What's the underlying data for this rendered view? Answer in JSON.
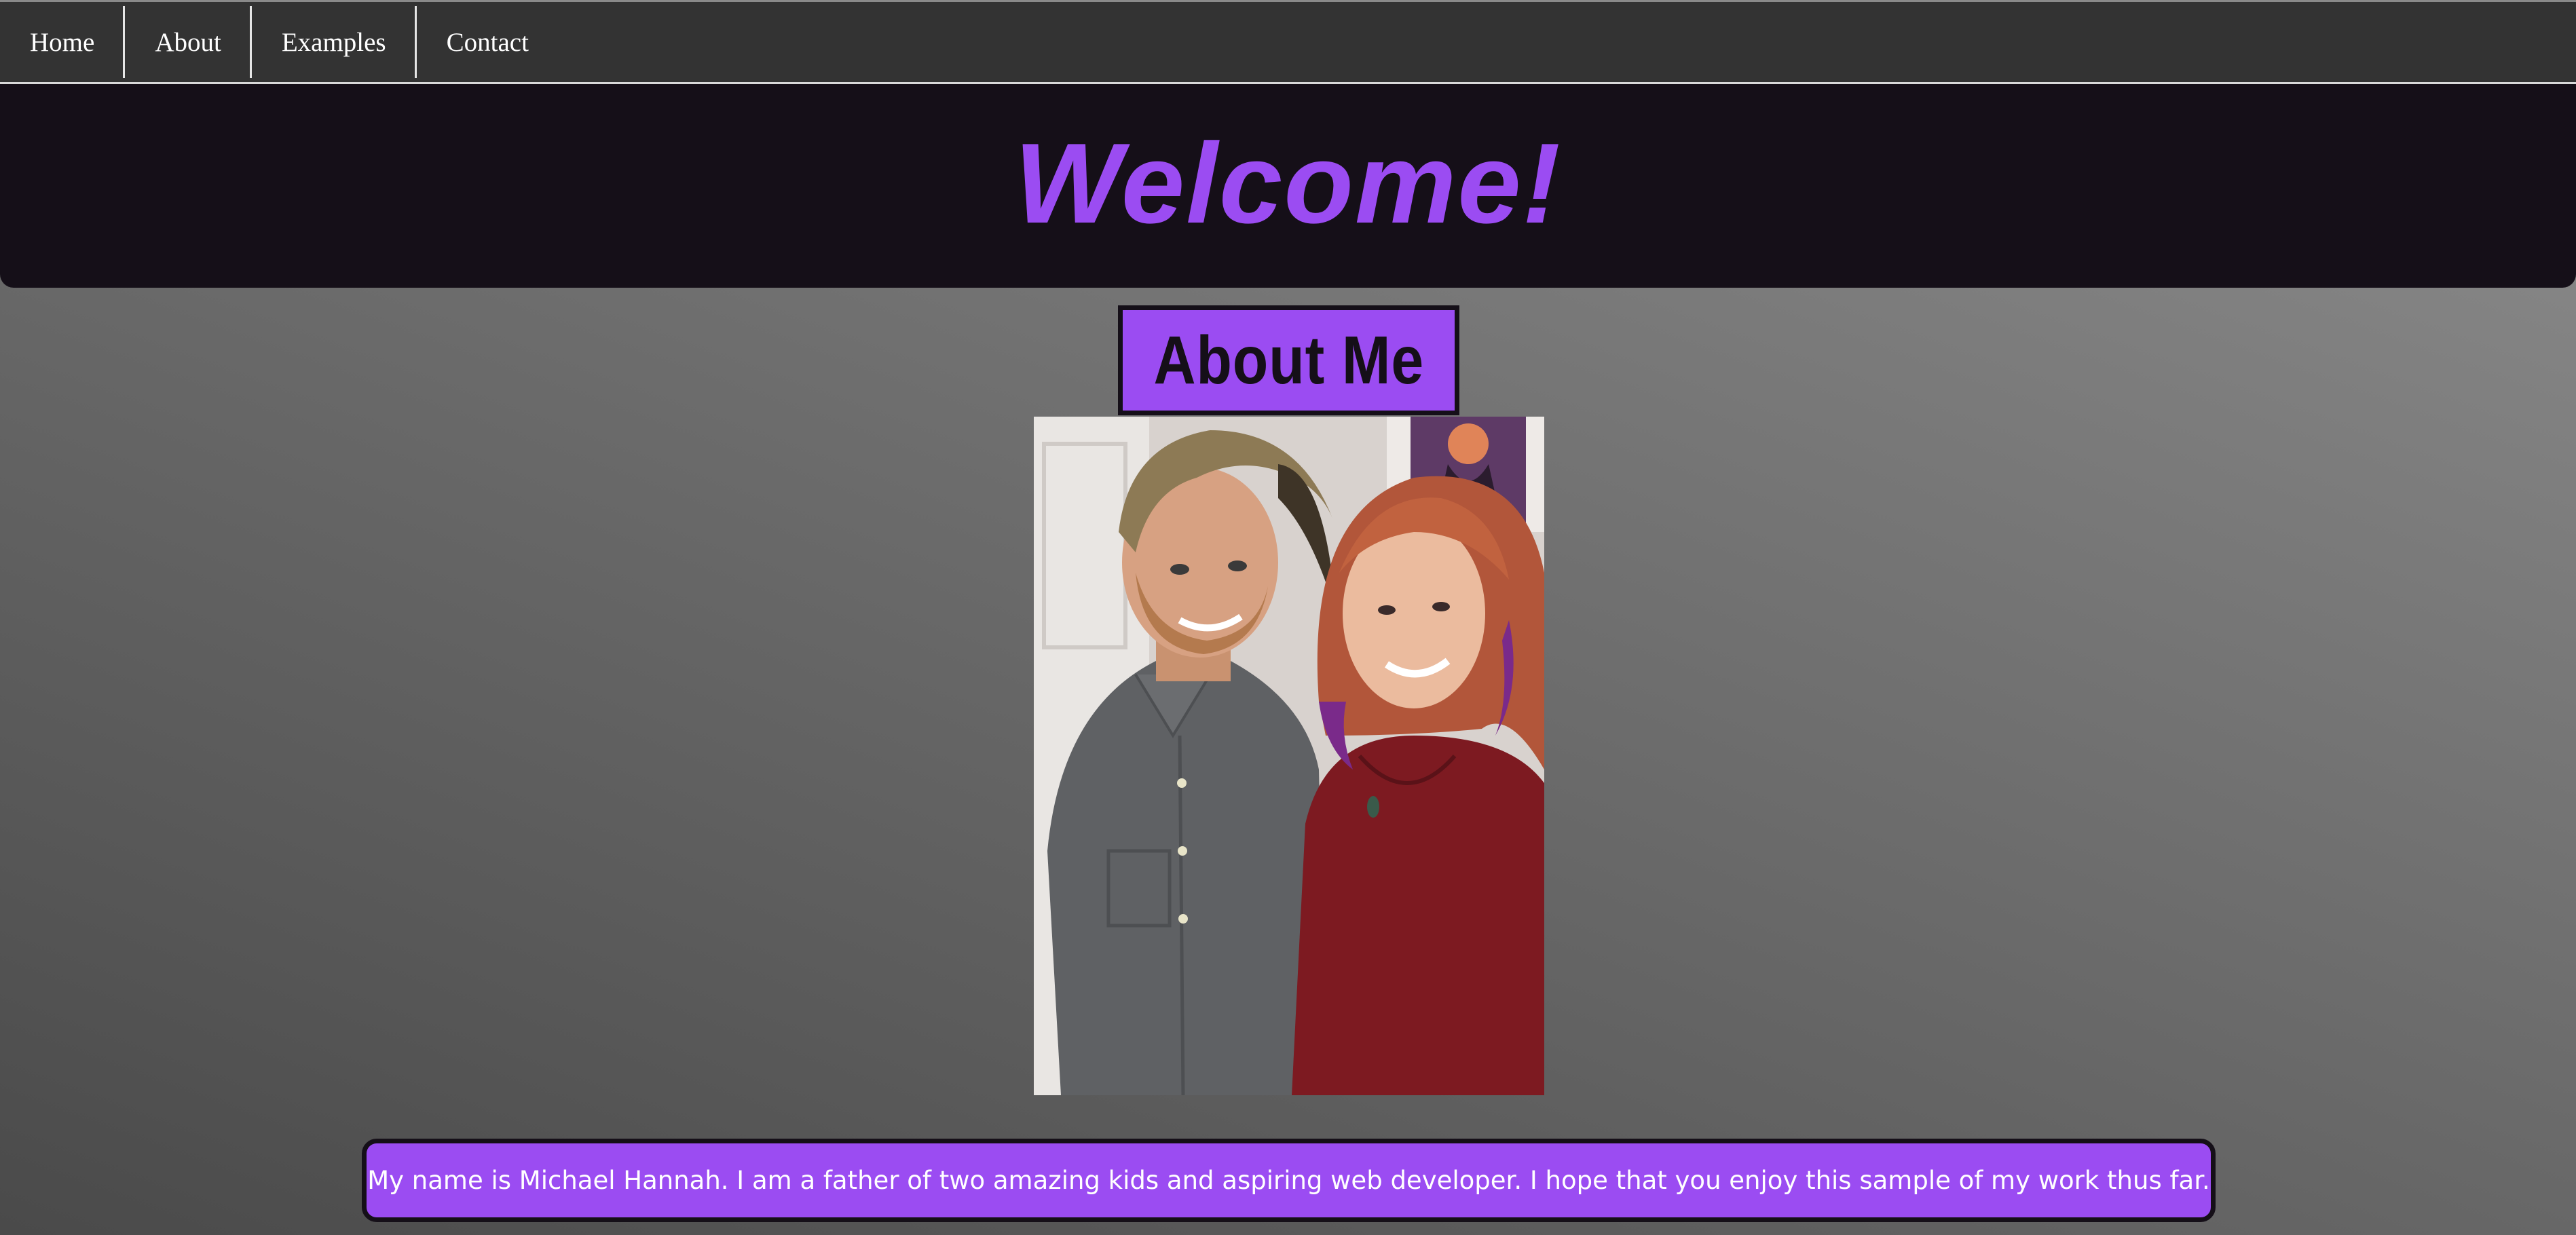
{
  "nav": {
    "items": [
      {
        "label": "Home"
      },
      {
        "label": "About"
      },
      {
        "label": "Examples"
      },
      {
        "label": "Contact"
      }
    ]
  },
  "header": {
    "title": "Welcome!"
  },
  "about": {
    "heading": "About Me",
    "bio": "My name is Michael Hannah. I am a father of two amazing kids and aspiring web developer. I hope that you enjoy this sample of my work thus far."
  },
  "colors": {
    "accent": "#9b4cf2",
    "dark": "#150f18",
    "navbar": "#333333"
  },
  "photo": {
    "icon": "portrait-photo"
  }
}
